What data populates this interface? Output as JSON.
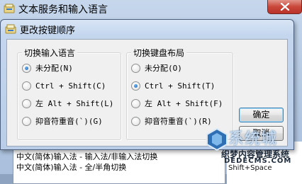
{
  "background_window": {
    "title": "文本服务和输入语言",
    "list_items": [
      "中文(简体)输入法 - 输入法/非输入法切换",
      "中文(简体)输入法 - 全/半角切换"
    ],
    "extra_text": "Shift+Space"
  },
  "dialog": {
    "title": "更改按键顺序",
    "input_language_group": {
      "title": "切换输入语言",
      "options": [
        "未分配(N)",
        "Ctrl + Shift(C)",
        "左 Alt + Shift(L)",
        "抑音符重音(`)(G)"
      ],
      "selected_index": 0
    },
    "keyboard_layout_group": {
      "title": "切换键盘布局",
      "options": [
        "未分配(O)",
        "Ctrl + Shift(T)",
        "左 Alt + Shift(F)",
        "抑音符重音(`)(R)"
      ],
      "selected_index": 1
    },
    "ok_label": "确定",
    "cancel_label": "取消"
  },
  "watermark": {
    "title": "系统城",
    "subtitle": "织梦内容管理系统",
    "domain": "DEDECMS.COM"
  },
  "colors": {
    "title_bar": "#c4d6ee",
    "close_button": "#c9473a",
    "dialog_body": "#f0f0f0",
    "radio_dot": "#1b63b5"
  }
}
